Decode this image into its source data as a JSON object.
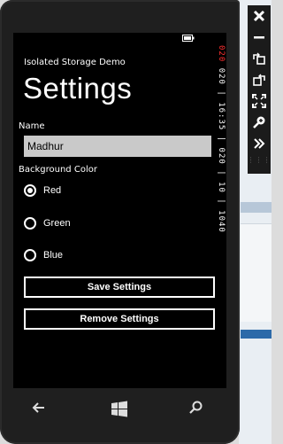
{
  "app": {
    "name": "Isolated Storage Demo",
    "page_title": "Settings"
  },
  "status_bar": {
    "icon": "battery-icon"
  },
  "debug_counter": {
    "red": "020",
    "white": "020 | 16:35 | 020 | 10 | 1040"
  },
  "form": {
    "name_label": "Name",
    "name_value": "Madhur",
    "bg_label": "Background Color",
    "colors": [
      {
        "label": "Red",
        "selected": true
      },
      {
        "label": "Green",
        "selected": false
      },
      {
        "label": "Blue",
        "selected": false
      }
    ],
    "save_label": "Save Settings",
    "remove_label": "Remove Settings"
  },
  "hardware": {
    "back": "back-icon",
    "start": "windows-start-icon",
    "search": "search-icon"
  },
  "toolbar": {
    "items": [
      "close-icon",
      "minimize-icon",
      "rotate-left-icon",
      "rotate-right-icon",
      "fit-to-screen-icon",
      "zoom-icon",
      "more-tools-icon"
    ]
  }
}
